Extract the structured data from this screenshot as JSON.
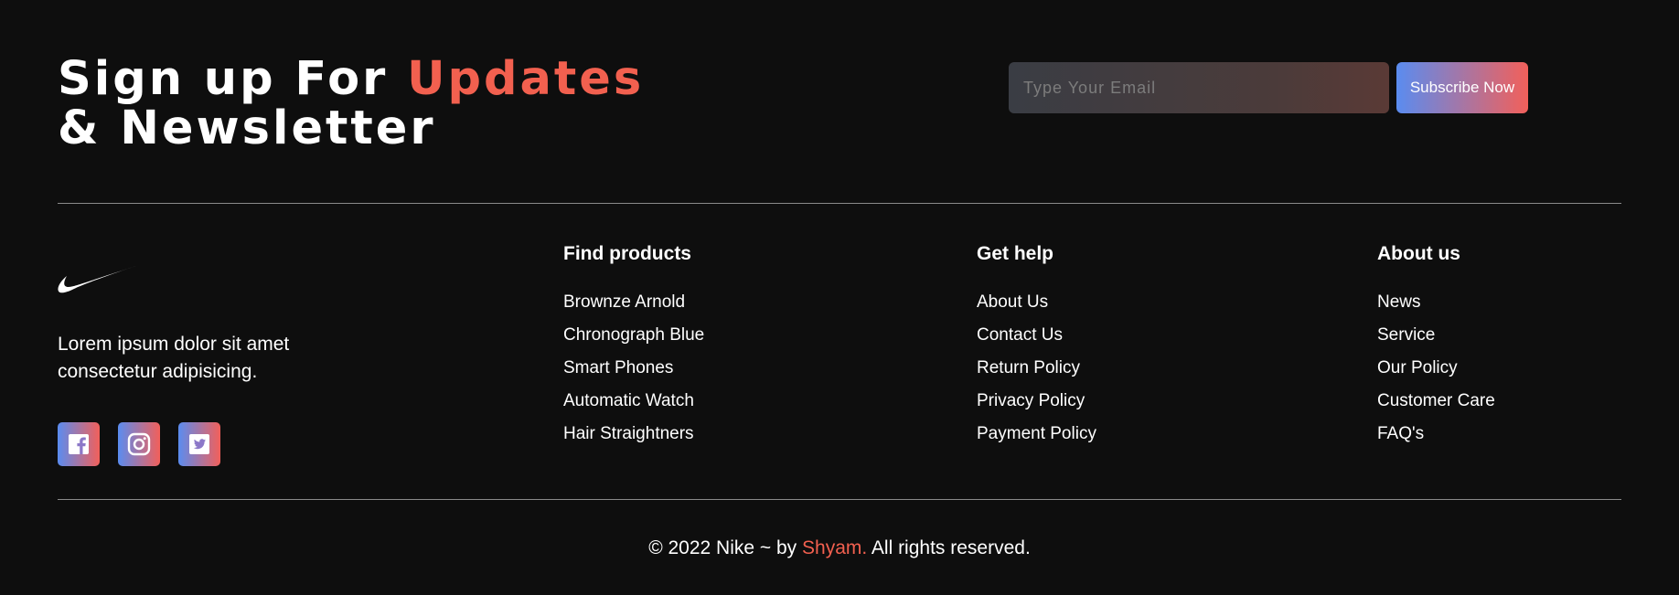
{
  "newsletter": {
    "title_part1": "Sign up For ",
    "title_accent": "Updates",
    "title_part2": "& Newsletter",
    "email_placeholder": "Type Your Email",
    "subscribe_label": "Subscribe Now"
  },
  "brand": {
    "logo_icon": "nike-swoosh-icon",
    "description": "Lorem ipsum dolor sit amet consectetur adipisicing.",
    "socials": [
      {
        "icon": "facebook-icon"
      },
      {
        "icon": "instagram-icon"
      },
      {
        "icon": "twitter-icon"
      }
    ]
  },
  "columns": [
    {
      "heading": "Find products",
      "links": [
        "Brownze Arnold",
        "Chronograph Blue",
        "Smart Phones",
        "Automatic Watch",
        "Hair Straightners"
      ]
    },
    {
      "heading": "Get help",
      "links": [
        "About Us",
        "Contact Us",
        "Return Policy",
        "Privacy Policy",
        "Payment Policy"
      ]
    },
    {
      "heading": "About us",
      "links": [
        "News",
        "Service",
        "Our Policy",
        "Customer Care",
        "FAQ's"
      ]
    }
  ],
  "copyright": {
    "prefix": "© 2022 Nike ~ by ",
    "author": "Shyam.",
    "suffix": " All rights reserved."
  },
  "colors": {
    "background": "#0e0e0e",
    "accent": "#f2604f",
    "gradient_start": "#5a8cf0",
    "gradient_end": "#f2605a"
  }
}
